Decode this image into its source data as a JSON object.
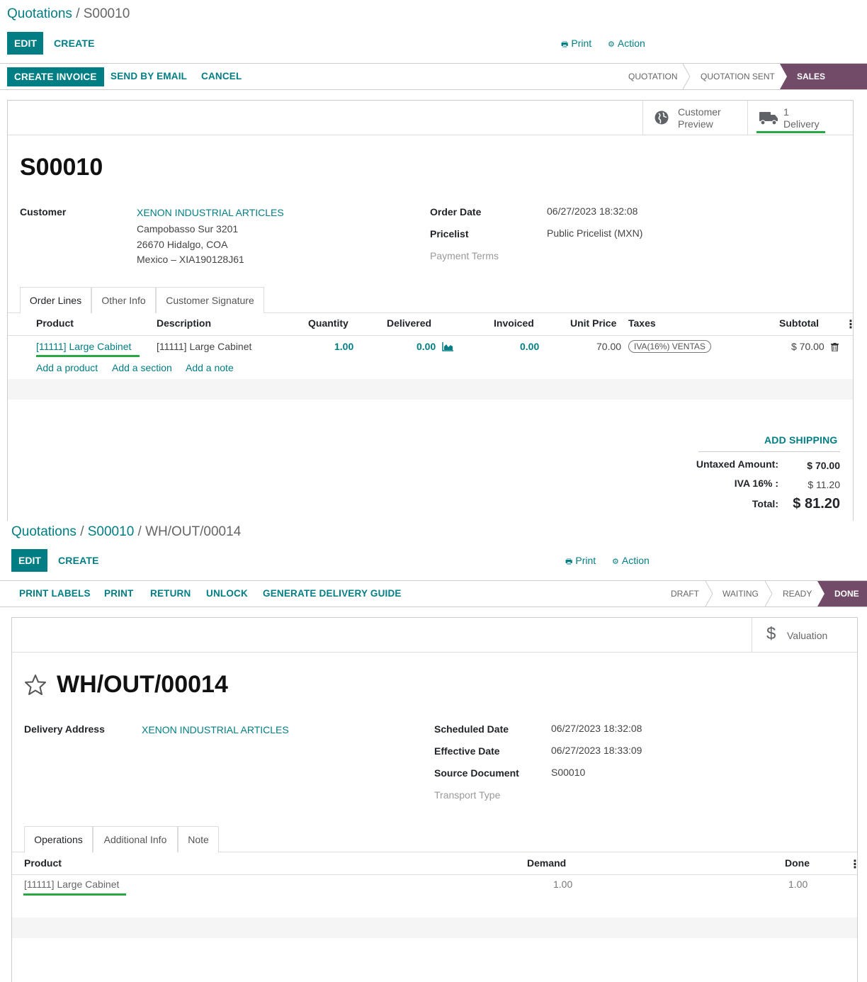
{
  "sale": {
    "breadcrumb": {
      "parent": "Quotations",
      "sep": "/",
      "current": "S00010"
    },
    "edit_label": "EDIT",
    "create_label": "CREATE",
    "print_label": "Print",
    "action_label": "Action",
    "status_buttons": [
      "CREATE INVOICE",
      "SEND BY EMAIL",
      "CANCEL"
    ],
    "stages": [
      "QUOTATION",
      "QUOTATION SENT",
      "SALES ORDER"
    ],
    "active_stage": "SALES ORDER",
    "smart_buttons": {
      "preview_line1": "Customer",
      "preview_line2": "Preview",
      "delivery_count": "1",
      "delivery_label": "Delivery"
    },
    "title": "S00010",
    "customer_label": "Customer",
    "customer_name": "XENON INDUSTRIAL ARTICLES",
    "customer_address": [
      "Campobasso Sur 3201",
      "26670 Hidalgo, COA",
      "Mexico – XIA190128J61"
    ],
    "order_date_label": "Order Date",
    "order_date": "06/27/2023 18:32:08",
    "pricelist_label": "Pricelist",
    "pricelist": "Public Pricelist (MXN)",
    "payment_terms_label": "Payment Terms",
    "tabs": [
      "Order Lines",
      "Other Info",
      "Customer Signature"
    ],
    "columns": [
      "Product",
      "Description",
      "Quantity",
      "Delivered",
      "Invoiced",
      "Unit Price",
      "Taxes",
      "Subtotal"
    ],
    "line": {
      "product": "[11111] Large Cabinet",
      "description": "[11111] Large Cabinet",
      "quantity": "1.00",
      "delivered": "0.00",
      "invoiced": "0.00",
      "unit_price": "70.00",
      "tax": "IVA(16%) VENTAS",
      "subtotal": "$ 70.00"
    },
    "add_links": [
      "Add a product",
      "Add a section",
      "Add a note"
    ],
    "add_shipping": "ADD SHIPPING",
    "untaxed_label": "Untaxed Amount:",
    "untaxed_value": "$ 70.00",
    "tax_label": "IVA 16% :",
    "tax_value": "$ 11.20",
    "total_label": "Total:",
    "total_value": "$ 81.20"
  },
  "picking": {
    "breadcrumb": {
      "root": "Quotations",
      "mid": "S00010",
      "current": "WH/OUT/00014",
      "sep": "/"
    },
    "edit_label": "EDIT",
    "create_label": "CREATE",
    "print_label": "Print",
    "action_label": "Action",
    "status_buttons": [
      "PRINT LABELS",
      "PRINT",
      "RETURN",
      "UNLOCK",
      "GENERATE DELIVERY GUIDE"
    ],
    "stages": [
      "DRAFT",
      "WAITING",
      "READY",
      "DONE"
    ],
    "active_stage": "DONE",
    "valuation_label": "Valuation",
    "title": "WH/OUT/00014",
    "delivery_address_label": "Delivery Address",
    "delivery_address": "XENON INDUSTRIAL ARTICLES",
    "scheduled_date_label": "Scheduled Date",
    "scheduled_date": "06/27/2023 18:32:08",
    "effective_date_label": "Effective Date",
    "effective_date": "06/27/2023 18:33:09",
    "source_document_label": "Source Document",
    "source_document": "S00010",
    "transport_type_label": "Transport Type",
    "tabs": [
      "Operations",
      "Additional Info",
      "Note"
    ],
    "columns": [
      "Product",
      "Demand",
      "Done"
    ],
    "line": {
      "product": "[11111] Large Cabinet",
      "demand": "1.00",
      "done": "1.00"
    }
  },
  "colors": {
    "primary": "#017e84",
    "stage_active": "#714b67",
    "success": "#28a745"
  },
  "icons": [
    "print-icon",
    "gear-icon",
    "globe-icon",
    "truck-icon",
    "area-chart-icon",
    "trash-icon",
    "kebab-icon",
    "star-icon",
    "dollar-icon"
  ]
}
